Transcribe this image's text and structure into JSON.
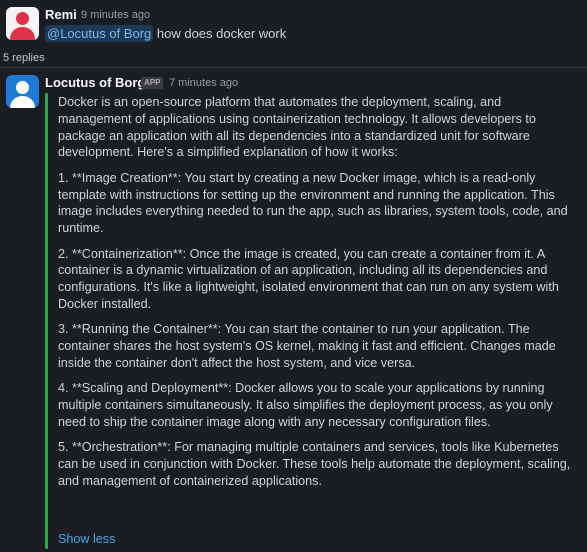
{
  "message1": {
    "author": "Remi",
    "time": "9 minutes ago",
    "mention": "@Locutus of Borg",
    "text": "how does docker work"
  },
  "thread": {
    "replies_label": "5 replies"
  },
  "message2": {
    "author": "Locutus of Borg",
    "badge": "APP",
    "time": "7 minutes ago",
    "paragraphs": [
      "Docker is an open-source platform that automates the deployment, scaling, and management of applications using containerization technology. It allows developers to package an application with all its dependencies into a standardized unit for software development. Here's a simplified explanation of how it works:",
      "1. **Image Creation**: You start by creating a new Docker image, which is a read-only template with instructions for setting up the environment and running the application. This image includes everything needed to run the app, such as libraries, system tools, code, and runtime.",
      "2. **Containerization**: Once the image is created, you can create a container from it. A container is a dynamic virtualization of an application, including all its dependencies and configurations. It's like a lightweight, isolated environment that can run on any system with Docker installed.",
      "3. **Running the Container**: You can start the container to run your application. The container shares the host system's OS kernel, making it fast and efficient. Changes made inside the container don't affect the host system, and vice versa.",
      "4. **Scaling and Deployment**: Docker allows you to scale your applications by running multiple containers simultaneously. It also simplifies the deployment process, as you only need to ship the container image along with any necessary configuration files.",
      "5. **Orchestration**: For managing multiple containers and services, tools like Kubernetes can be used in conjunction with Docker. These tools help automate the deployment, scaling, and management of containerized applications."
    ],
    "show_less": "Show less"
  },
  "colors": {
    "background": "#1a1d21",
    "accent_bar": "#2bac48",
    "link": "#4aa3e6",
    "mention_bg": "#1b3a55",
    "remi_avatar": "#e0334a",
    "bot_avatar": "#1d7bd6"
  }
}
